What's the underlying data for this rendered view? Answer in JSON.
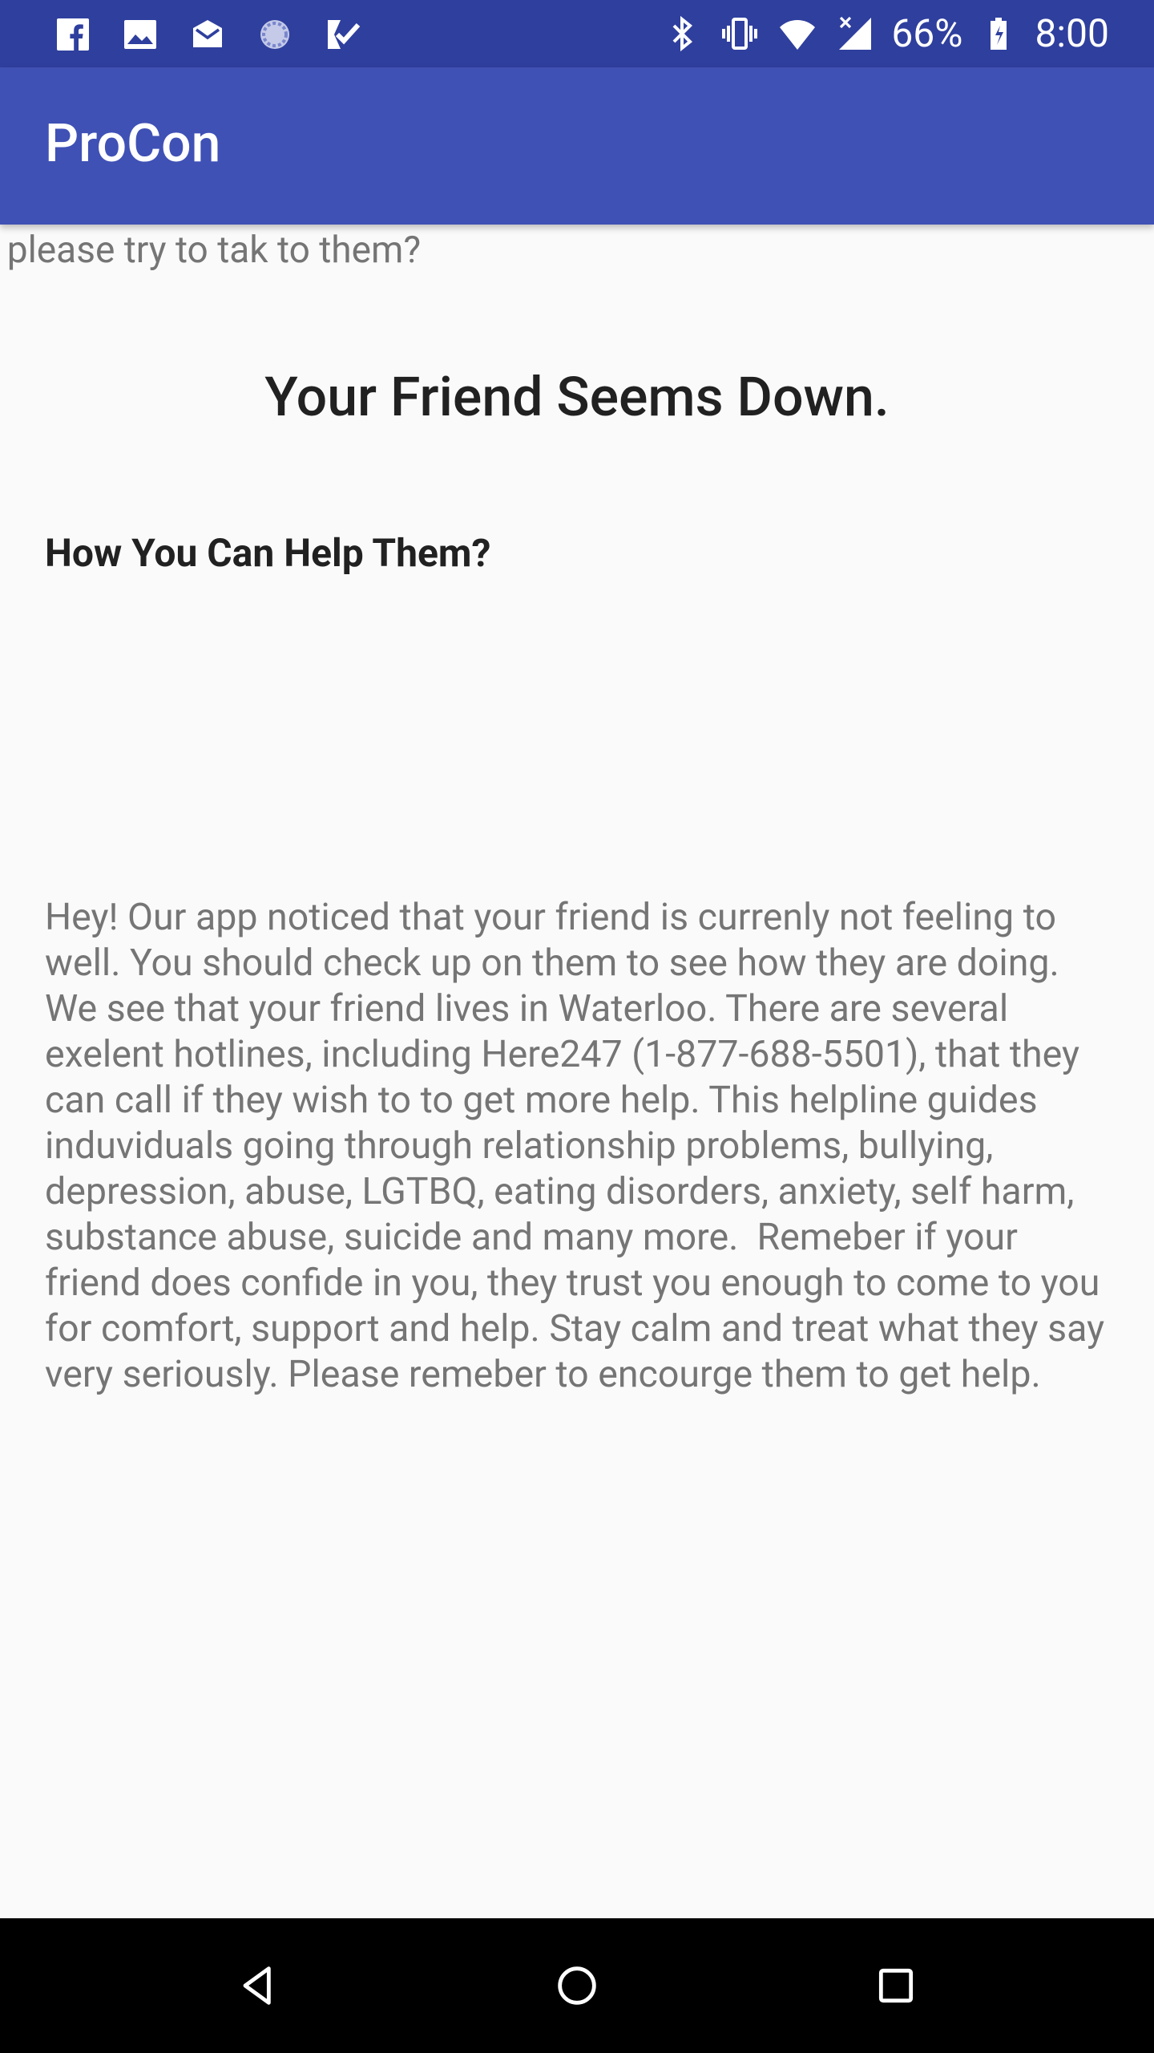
{
  "status_bar": {
    "notifications": [
      "facebook-icon",
      "image-icon",
      "mail-icon",
      "sync-icon",
      "task-icon"
    ],
    "system_icons": [
      "bluetooth-icon",
      "vibrate-icon",
      "wifi-icon",
      "signal-icon"
    ],
    "battery_percent": "66%",
    "time": "8:00"
  },
  "appbar": {
    "title": "ProCon"
  },
  "content": {
    "partial_text": "u please try to tak to them?",
    "headline": "Your Friend Seems Down.",
    "subhead": "How You Can Help Them?",
    "body": "Hey! Our app noticed that your friend is currenly not feeling to well. You should check up on them to see how they are doing. We see that your friend lives in Waterloo. There are several exelent hotlines, including Here247 (1-877-688-5501), that they can call if they wish to to get more help. This helpline guides induviduals going through relationship problems, bullying, depression, abuse, LGTBQ, eating disorders, anxiety, self harm, substance abuse, suicide and many more.  Remeber if your friend does confide in you, they trust you enough to come to you for comfort, support and help. Stay calm and treat what they say very seriously. Please remeber to encourge them to get help."
  },
  "navbar": {
    "buttons": [
      "back-icon",
      "home-icon",
      "recents-icon"
    ]
  },
  "colors": {
    "status_bar": "#2f3f9e",
    "app_bar": "#3f51b5",
    "background": "#fafafa",
    "nav_bar": "#000000"
  }
}
